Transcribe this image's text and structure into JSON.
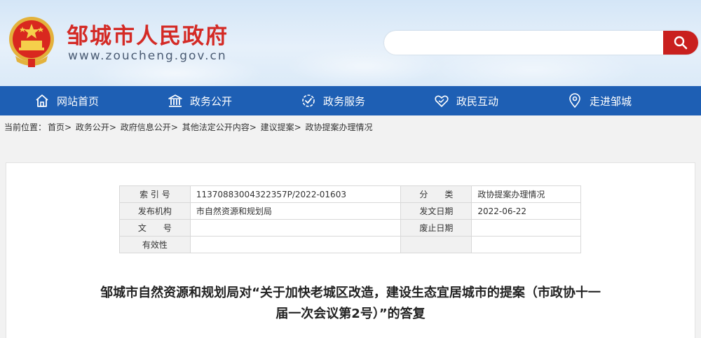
{
  "header": {
    "title": "邹城市人民政府",
    "domain": "www.zoucheng.gov.cn",
    "search": {
      "value": "",
      "placeholder": ""
    }
  },
  "nav": [
    {
      "label": "网站首页",
      "icon": "home-icon"
    },
    {
      "label": "政务公开",
      "icon": "government-building-icon"
    },
    {
      "label": "政务服务",
      "icon": "service-icon"
    },
    {
      "label": "政民互动",
      "icon": "heart-handshake-icon"
    },
    {
      "label": "走进邹城",
      "icon": "location-pin-icon"
    }
  ],
  "breadcrumb": {
    "prefix": "当前位置：",
    "items": [
      "首页",
      "政务公开",
      "政府信息公开",
      "其他法定公开内容",
      "建议提案",
      "政协提案办理情况"
    ]
  },
  "meta": {
    "index_label": "索 引 号",
    "index_value": "11370883004322357P/2022-01603",
    "category_label": "分　　类",
    "category_value": "政协提案办理情况",
    "publisher_label": "发布机构",
    "publisher_value": "市自然资源和规划局",
    "date_label": "发文日期",
    "date_value": "2022-06-22",
    "docno_label": "文　　号",
    "docno_value": "",
    "expire_label": "废止日期",
    "expire_value": "",
    "validity_label": "有效性",
    "validity_value": ""
  },
  "document": {
    "title_line1": "邹城市自然资源和规划局对“关于加快老城区改造，建设生态宜居城市的提案（市政协十一",
    "title_line2": "届一次会议第2号）”的答复"
  },
  "colors": {
    "brand_red": "#d42a25",
    "nav_blue": "#1e5fb4",
    "search_red": "#c9201e"
  }
}
